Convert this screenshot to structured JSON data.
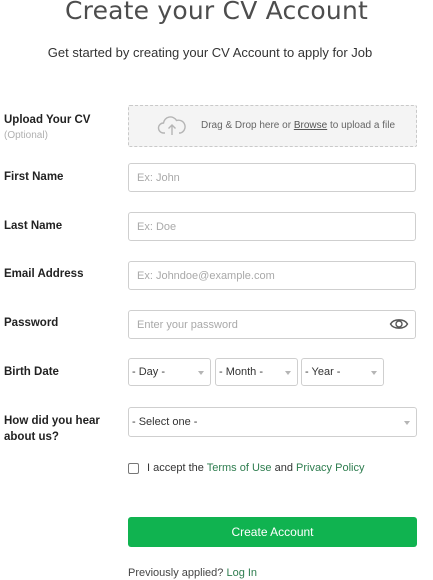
{
  "header": {
    "title": "Create your CV Account",
    "subtitle": "Get started by creating your CV Account to apply for Job"
  },
  "form": {
    "upload": {
      "label": "Upload Your CV",
      "optional": "(Optional)",
      "text_before": "Drag & Drop here or ",
      "browse": "Browse",
      "text_after": " to upload a file",
      "icon": "cloud-upload-icon"
    },
    "first_name": {
      "label": "First Name",
      "placeholder": "Ex: John"
    },
    "last_name": {
      "label": "Last Name",
      "placeholder": "Ex: Doe"
    },
    "email": {
      "label": "Email Address",
      "placeholder": "Ex: Johndoe@example.com"
    },
    "password": {
      "label": "Password",
      "placeholder": "Enter your password",
      "icon": "eye-icon"
    },
    "birth_date": {
      "label": "Birth Date",
      "day": "- Day -",
      "month": "- Month -",
      "year": "- Year -"
    },
    "source": {
      "label": "How did you hear about us?",
      "selected": "- Select one -"
    },
    "terms": {
      "prefix": "I accept the ",
      "terms_link": "Terms of Use",
      "and": " and ",
      "privacy_link": "Privacy Policy"
    },
    "submit": "Create Account",
    "footer": {
      "text": "Previously applied? ",
      "link": "Log In"
    }
  },
  "colors": {
    "accent": "#10b350",
    "link": "#2e7d4f"
  }
}
